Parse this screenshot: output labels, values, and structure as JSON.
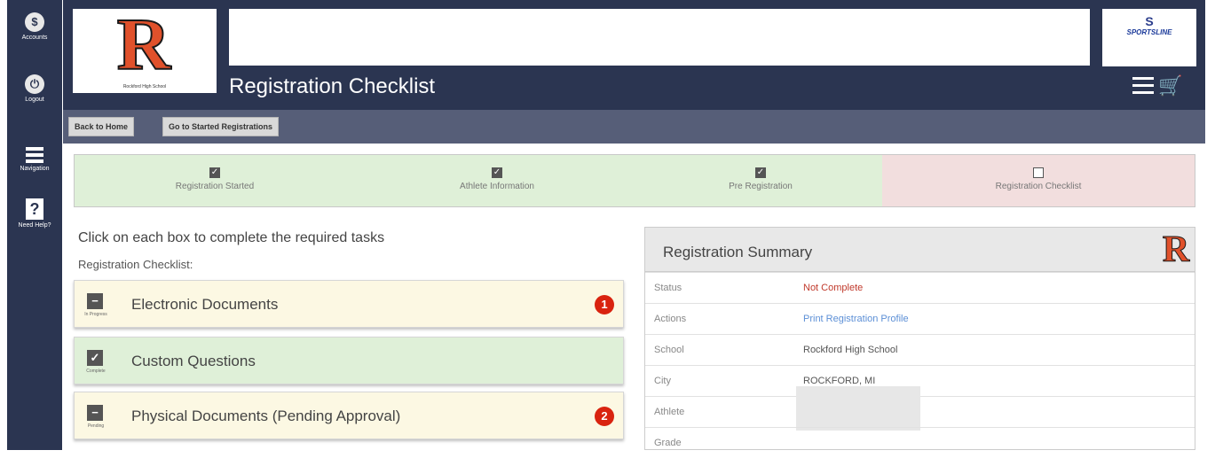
{
  "rail": {
    "account_label": "Accounts",
    "account_glyph": "$",
    "logout_label": "Logout",
    "logout_glyph": "⏻",
    "navigation_label": "Navigation",
    "help_label": "Need Help?",
    "help_glyph": "?"
  },
  "header": {
    "school_logo_letter": "R",
    "school_name_caption": "Rockford High School",
    "sponsor_glyph": "S",
    "sponsor_name": "SPORTSLINE",
    "page_title": "Registration Checklist",
    "cart_glyph": "🛒"
  },
  "toolbar": {
    "back_home_label": "Back to Home",
    "started_label": "Go to Started Registrations"
  },
  "steps": [
    {
      "label": "Registration Started",
      "status": "done",
      "glyph": "✓"
    },
    {
      "label": "Athlete Information",
      "status": "done",
      "glyph": "✓"
    },
    {
      "label": "Pre Registration",
      "status": "done",
      "glyph": "✓"
    },
    {
      "label": "Registration Checklist",
      "status": "current",
      "glyph": ""
    }
  ],
  "main": {
    "instructions": "Click on each box to complete the required tasks",
    "checklist_label": "Registration Checklist:"
  },
  "tasks": [
    {
      "title": "Electronic Documents",
      "state": "In Progress",
      "icon_glyph": "−",
      "badge": "1",
      "color": "#fcf8e3"
    },
    {
      "title": "Custom Questions",
      "state": "Complete",
      "icon_glyph": "✓",
      "badge": "",
      "color": "#dff0d8"
    },
    {
      "title": "Physical Documents (Pending Approval)",
      "state": "Pending",
      "icon_glyph": "−",
      "badge": "2",
      "color": "#fcf8e3"
    }
  ],
  "summary": {
    "title": "Registration Summary",
    "logo_letter": "R",
    "rows": [
      {
        "label": "Status",
        "value": "Not Complete"
      },
      {
        "label": "Actions",
        "value": "Print Registration Profile"
      },
      {
        "label": "School",
        "value": "Rockford High School"
      },
      {
        "label": "City",
        "value": "ROCKFORD, MI"
      },
      {
        "label": "Athlete",
        "value": ""
      },
      {
        "label": "Grade",
        "value": ""
      }
    ]
  },
  "colors": {
    "nav_bg": "#2b3551",
    "toolbar_bg": "#565e78",
    "done_bg": "#dff0d8",
    "current_bg": "#f2dede",
    "pending_bg": "#fcf8e3",
    "badge_red": "#d9230f",
    "status_red": "#c0392b",
    "link_blue": "#5c8fd6"
  }
}
